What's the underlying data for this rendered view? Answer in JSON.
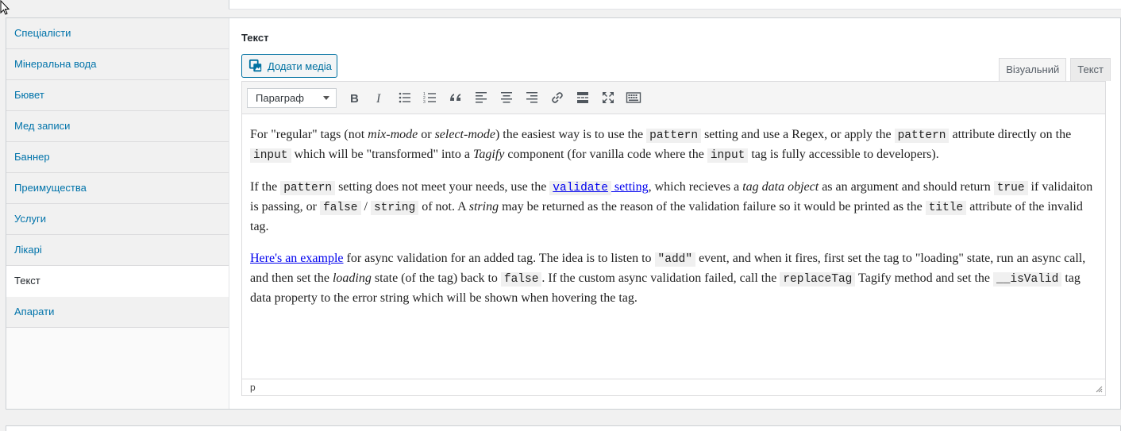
{
  "tabs": [
    {
      "label": "Спеціалісти",
      "active": false
    },
    {
      "label": "Мінеральна вода",
      "active": false
    },
    {
      "label": "Бювет",
      "active": false
    },
    {
      "label": "Мед записи",
      "active": false
    },
    {
      "label": "Баннер",
      "active": false
    },
    {
      "label": "Преимущества",
      "active": false
    },
    {
      "label": "Услуги",
      "active": false
    },
    {
      "label": "Лікарі",
      "active": false
    },
    {
      "label": "Текст",
      "active": true
    },
    {
      "label": "Апарати",
      "active": false
    }
  ],
  "field": {
    "label": "Текст"
  },
  "media_button": {
    "label": "Додати медіа",
    "icon": "add-media-icon"
  },
  "mode_tabs": {
    "visual": "Візуальний",
    "text": "Текст"
  },
  "toolbar": {
    "format_select": "Параграф",
    "buttons": [
      "bold",
      "italic",
      "bullet-list",
      "numbered-list",
      "blockquote",
      "align-left",
      "align-center",
      "align-right",
      "link",
      "read-more",
      "fullscreen",
      "toolbar-toggle"
    ]
  },
  "content": {
    "p1": {
      "t1": "For \"regular\" tags (not ",
      "i1": "mix-mode",
      "t2": " or ",
      "i2": "select-mode",
      "t3": ") the easiest way is to use the ",
      "c1": "pattern",
      "t4": " setting and use a Regex, or apply the ",
      "c2": "pattern",
      "t5": " attribute directly on the ",
      "c3": "input",
      "t6": " which will be \"transformed\" into a ",
      "i3": "Tagify",
      "t7": " component (for vanilla code where the ",
      "c4": "input",
      "t8": " tag is fully accessible to developers)."
    },
    "p2": {
      "t1": "If the ",
      "c1": "pattern",
      "t2": " setting does not meet your needs, use the ",
      "link_code": "validate",
      "link_text": " setting",
      "t3": ", which recieves a ",
      "i1": "tag data object",
      "t4": " as an argument and should return ",
      "c2": "true",
      "t5": " if validaiton is passing, or ",
      "c3": "false",
      "t6": " / ",
      "c4": "string",
      "t7": " of not. A ",
      "i2": "string",
      "t8": " may be returned as the reason of the validation failure so it would be printed as the ",
      "c5": "title",
      "t9": " attribute of the invalid tag."
    },
    "p3": {
      "link": "Here's an example",
      "t1": " for async validation for an added tag. The idea is to listen to ",
      "c1": "\"add\"",
      "t2": " event, and when it fires, first set the tag to \"loading\" state, run an async call, and then set the ",
      "i1": "loading",
      "t3": " state (of the tag) back to ",
      "c2": "false",
      "t4": ". If the custom async validation failed, call the ",
      "c3": "replaceTag",
      "t5": " Tagify method and set the ",
      "c4": "__isValid",
      "t6": " tag data property to the error string which will be shown when hovering the tag."
    }
  },
  "statusbar": {
    "path": "p"
  }
}
